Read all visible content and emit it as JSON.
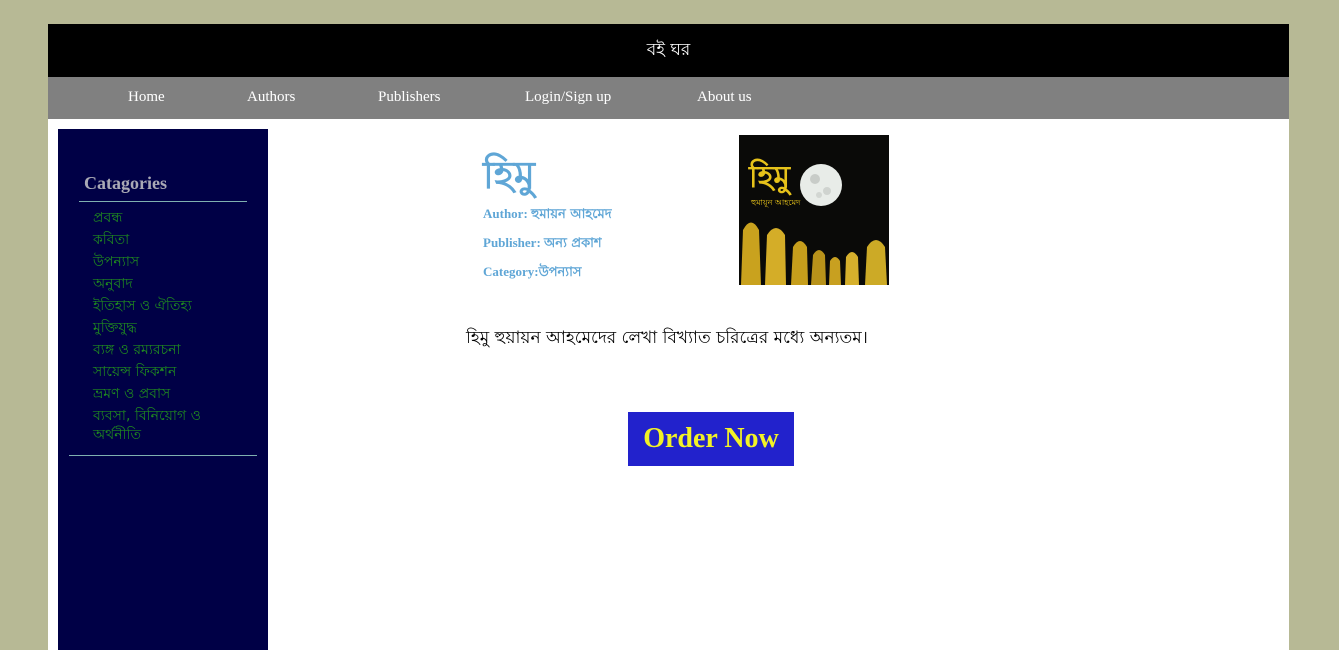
{
  "header": {
    "site_title": "বই ঘর"
  },
  "nav": {
    "items": [
      {
        "label": "Home"
      },
      {
        "label": "Authors"
      },
      {
        "label": "Publishers"
      },
      {
        "label": "Login/Sign up"
      },
      {
        "label": "About us"
      }
    ]
  },
  "sidebar": {
    "title": "Catagories",
    "items": [
      {
        "label": "প্রবন্ধ"
      },
      {
        "label": "কবিতা"
      },
      {
        "label": "উপন্যাস"
      },
      {
        "label": "অনুবাদ"
      },
      {
        "label": "ইতিহাস ও ঐতিহ্য"
      },
      {
        "label": "মুক্তিযুদ্ধ"
      },
      {
        "label": "ব্যঙ্গ ও রম্যরচনা"
      },
      {
        "label": "সায়েন্স ফিকশন"
      },
      {
        "label": "ভ্রমণ ও প্রবাস"
      },
      {
        "label": "ব্যবসা, বিনিয়োগ ও অর্থনীতি"
      }
    ]
  },
  "book": {
    "title": "হিমু",
    "author_label": "Author:",
    "author": "হুমায়ন আহমেদ",
    "publisher_label": "Publisher:",
    "publisher": "অন্য প্রকাশ",
    "category_label": "Category:",
    "category": "উপন্যাস",
    "cover": {
      "title_text": "হিমু",
      "author_text": "হুমায়ূন আহমেদ"
    },
    "description": "হিমু হুয়ায়ন আহমেদের লেখা বিখ্যাত চরিত্রের মধ্যে অন্যতম।"
  },
  "order": {
    "label": "Order Now"
  },
  "colors": {
    "page_bg": "#b7b995",
    "header_bg": "#000000",
    "nav_bg": "#808080",
    "sidebar_bg": "#000046",
    "category_text": "#1f8a1f",
    "book_accent": "#5fa6d6",
    "order_bg": "#2222cc",
    "order_text": "#f2f226"
  }
}
